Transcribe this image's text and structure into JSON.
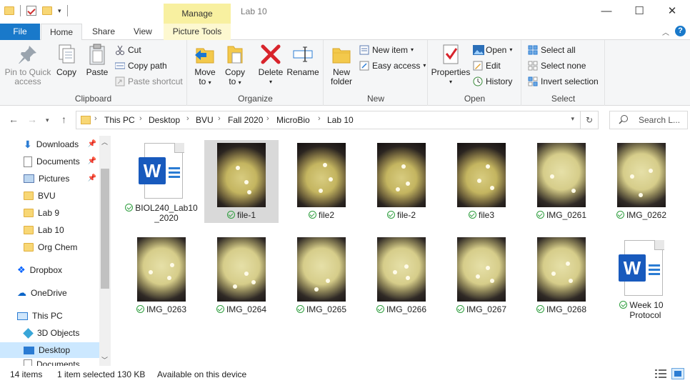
{
  "title": "Lab 10",
  "contextual_tab": "Manage",
  "window_controls": {
    "minimize": "—",
    "maximize": "☐",
    "close": "✕"
  },
  "tabs": {
    "file": "File",
    "home": "Home",
    "share": "Share",
    "view": "View",
    "picture_tools": "Picture Tools"
  },
  "ribbon": {
    "clipboard": {
      "label": "Clipboard",
      "pin": "Pin to Quick access",
      "pin_l1": "Pin to Quick",
      "pin_l2": "access",
      "copy": "Copy",
      "paste": "Paste",
      "cut": "Cut",
      "copy_path": "Copy path",
      "paste_shortcut": "Paste shortcut"
    },
    "organize": {
      "label": "Organize",
      "move_to_l1": "Move",
      "move_to_l2": "to",
      "copy_to_l1": "Copy",
      "copy_to_l2": "to",
      "delete": "Delete",
      "rename": "Rename"
    },
    "new": {
      "label": "New",
      "new_folder_l1": "New",
      "new_folder_l2": "folder",
      "new_item": "New item",
      "easy_access": "Easy access"
    },
    "open": {
      "label": "Open",
      "properties": "Properties",
      "open": "Open",
      "edit": "Edit",
      "history": "History"
    },
    "select": {
      "label": "Select",
      "select_all": "Select all",
      "select_none": "Select none",
      "invert": "Invert selection"
    }
  },
  "address": {
    "segments": [
      "This PC",
      "Desktop",
      "BVU",
      "Fall 2020",
      "MicroBio",
      "Lab 10"
    ],
    "search_placeholder": "Search L..."
  },
  "nav": [
    {
      "label": "Downloads",
      "pinned": true
    },
    {
      "label": "Documents",
      "pinned": true
    },
    {
      "label": "Pictures",
      "pinned": true
    },
    {
      "label": "BVU"
    },
    {
      "label": "Lab 9"
    },
    {
      "label": "Lab 10"
    },
    {
      "label": "Org Chem"
    },
    {
      "label": "Dropbox"
    },
    {
      "label": "OneDrive"
    },
    {
      "label": "This PC"
    },
    {
      "label": "3D Objects"
    },
    {
      "label": "Desktop"
    },
    {
      "label": "Documents"
    }
  ],
  "files": [
    {
      "name": "BIOL240_Lab10",
      "name2": "_2020",
      "kind": "word"
    },
    {
      "name": "file-1",
      "kind": "photo",
      "selected": true
    },
    {
      "name": "file2",
      "kind": "photo"
    },
    {
      "name": "file-2",
      "kind": "photo"
    },
    {
      "name": "file3",
      "kind": "photo"
    },
    {
      "name": "IMG_0261",
      "kind": "photo"
    },
    {
      "name": "IMG_0262",
      "kind": "photo"
    },
    {
      "name": "IMG_0263",
      "kind": "photo"
    },
    {
      "name": "IMG_0264",
      "kind": "photo"
    },
    {
      "name": "IMG_0265",
      "kind": "photo"
    },
    {
      "name": "IMG_0266",
      "kind": "photo"
    },
    {
      "name": "IMG_0267",
      "kind": "photo"
    },
    {
      "name": "IMG_0268",
      "kind": "photo"
    },
    {
      "name": "Week 10",
      "name2": "Protocol",
      "kind": "word"
    }
  ],
  "status": {
    "count": "14 items",
    "selected": "1 item selected",
    "size": "130 KB",
    "availability": "Available on this device"
  },
  "colors": {
    "accent": "#1979ca",
    "manage": "#f8f0a0",
    "selection": "#cce8ff",
    "sync_ok": "#2e9e3e"
  }
}
